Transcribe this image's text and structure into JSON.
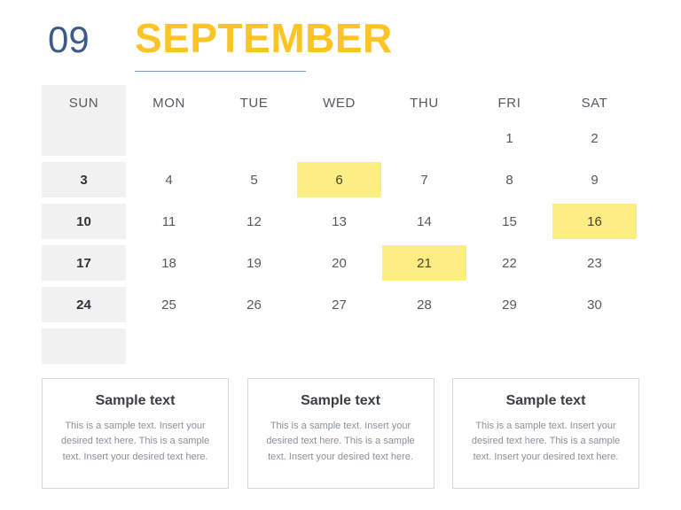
{
  "header": {
    "month_number": "09",
    "month_name": "SEPTEMBER",
    "accent_color": "#fdc423",
    "number_color": "#3d5a8a",
    "rule_color": "#7b9ac6"
  },
  "calendar": {
    "weekday_headers": [
      "SUN",
      "MON",
      "TUE",
      "WED",
      "THU",
      "FRI",
      "SAT"
    ],
    "sunday_shade_color": "#f1f1f1",
    "highlight_color": "#fced84",
    "weeks": [
      [
        "",
        "",
        "",
        "",
        "",
        "1",
        "2"
      ],
      [
        "3",
        "4",
        "5",
        "6",
        "7",
        "8",
        "9"
      ],
      [
        "10",
        "11",
        "12",
        "13",
        "14",
        "15",
        "16"
      ],
      [
        "17",
        "18",
        "19",
        "20",
        "21",
        "22",
        "23"
      ],
      [
        "24",
        "25",
        "26",
        "27",
        "28",
        "29",
        "30"
      ],
      [
        "",
        "",
        "",
        "",
        "",
        "",
        ""
      ]
    ],
    "highlighted_days": [
      "6",
      "16",
      "21"
    ]
  },
  "notes": [
    {
      "title": "Sample text",
      "body": "This is a sample text. Insert your desired text here. This is a sample text. Insert your desired text here."
    },
    {
      "title": "Sample text",
      "body": "This is a sample text. Insert your desired text here. This is a sample text. Insert your desired text here."
    },
    {
      "title": "Sample text",
      "body": "This is a sample text. Insert your desired text here. This is a sample text. Insert your desired text here."
    }
  ]
}
